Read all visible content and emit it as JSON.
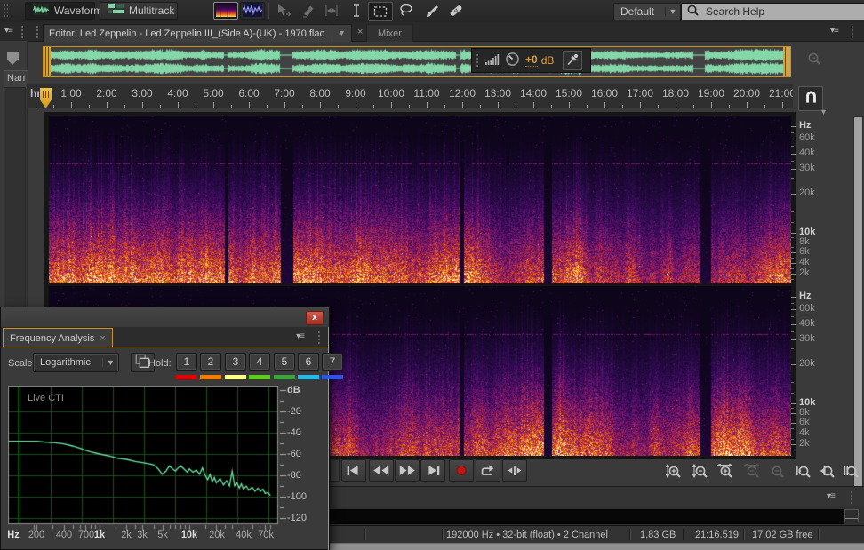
{
  "toolbar": {
    "waveform_label": "Waveform",
    "multitrack_label": "Multitrack",
    "workspace_value": "Default",
    "search_placeholder": "Search Help",
    "tools": [
      "move-tool",
      "slip-tool",
      "stretch-tool",
      "time-selection-tool",
      "marquee-selection-tool",
      "lasso-selection-tool",
      "paintbrush-tool",
      "spot-healing-brush-tool"
    ]
  },
  "tab_bar": {
    "editor_tab": "Editor: Led Zeppelin - Led Zeppelin III_(Side A)-(UK) - 1970.flac",
    "editor_close": "×",
    "mixer_tab": "Mixer"
  },
  "left_rail": {
    "column_header": "Nan"
  },
  "overview": {
    "gain_value": "+0",
    "gain_unit": "dB"
  },
  "ruler": {
    "unit": "hms",
    "ticks": [
      "1:00",
      "2:00",
      "3:00",
      "4:00",
      "5:00",
      "6:00",
      "7:00",
      "8:00",
      "9:00",
      "10:00",
      "11:00",
      "12:00",
      "13:00",
      "14:00",
      "15:00",
      "16:00",
      "17:00",
      "18:00",
      "19:00",
      "20:00",
      "21:00"
    ]
  },
  "spectrogram": {
    "channels": 2,
    "axis_labels": [
      "Hz",
      "60k",
      "40k",
      "30k",
      "20k",
      "10k",
      "8k",
      "6k",
      "4k",
      "2k"
    ],
    "axis_bold": [
      true,
      false,
      false,
      false,
      false,
      true,
      false,
      false,
      false,
      false
    ]
  },
  "transport": {
    "buttons": [
      "skip-to-start",
      "rewind",
      "fast-forward",
      "skip-to-end",
      "record",
      "loop-playback",
      "skip-selection"
    ]
  },
  "zoom_bar": {
    "buttons": [
      "zoom-in-amplitude",
      "zoom-out-amplitude",
      "zoom-in-time",
      "zoom-out-time",
      "zoom-reset",
      "zoom-in-left-selection",
      "zoom-in-right-selection",
      "zoom-to-selection"
    ]
  },
  "status_bar": {
    "segments": [
      "192000 Hz • 32-bit (float) • 2 Channel",
      "1,83 GB",
      "21:16.519",
      "17,02 GB free"
    ]
  },
  "freq_panel": {
    "tab_title": "Frequency Analysis",
    "tab_close": "×",
    "scale_label": "Scale:",
    "scale_value": "Logarithmic",
    "hold_label": "Hold:",
    "hold_buttons": [
      {
        "label": "1",
        "color": "#e00000"
      },
      {
        "label": "2",
        "color": "#f07d00"
      },
      {
        "label": "3",
        "color": "#ffff8c"
      },
      {
        "label": "4",
        "color": "#5ecc1e"
      },
      {
        "label": "5",
        "color": "#3da33d"
      },
      {
        "label": "6",
        "color": "#28b8e8"
      },
      {
        "label": "7",
        "color": "#2f55e0"
      }
    ],
    "overlay_label": "Live CTI"
  },
  "chart_data": {
    "type": "line",
    "title": "Frequency Analysis",
    "xlabel": "Hz",
    "ylabel": "dB",
    "x_scale": "log",
    "x_ticks": [
      "Hz",
      "200",
      "400",
      "700",
      "1k",
      "2k",
      "3k",
      "5k",
      "10k",
      "20k",
      "40k",
      "70k"
    ],
    "x_ticks_bold": [
      true,
      false,
      false,
      false,
      true,
      false,
      false,
      false,
      true,
      false,
      false,
      false
    ],
    "y_ticks": [
      "dB",
      "-20",
      "-40",
      "-60",
      "-80",
      "-100",
      "-120"
    ],
    "ylim": [
      -126,
      0
    ],
    "grid": true,
    "legend_position": "top-left",
    "series": [
      {
        "name": "Live CTI",
        "points": [
          [
            95,
            -48
          ],
          [
            150,
            -48
          ],
          [
            200,
            -48
          ],
          [
            260,
            -49
          ],
          [
            320,
            -49.5
          ],
          [
            400,
            -50.5
          ],
          [
            500,
            -52.5
          ],
          [
            600,
            -54.5
          ],
          [
            700,
            -56.5
          ],
          [
            800,
            -58
          ],
          [
            1000,
            -60
          ],
          [
            1300,
            -62
          ],
          [
            1600,
            -64
          ],
          [
            2000,
            -65
          ],
          [
            2500,
            -67
          ],
          [
            3000,
            -68
          ],
          [
            3500,
            -69
          ],
          [
            4000,
            -70
          ],
          [
            4500,
            -74
          ],
          [
            5000,
            -79
          ],
          [
            5500,
            -76
          ],
          [
            6000,
            -71
          ],
          [
            6500,
            -74
          ],
          [
            7000,
            -76
          ],
          [
            7500,
            -73
          ],
          [
            8000,
            -71
          ],
          [
            8700,
            -74
          ],
          [
            9500,
            -77
          ],
          [
            10000,
            -74
          ],
          [
            11000,
            -77
          ],
          [
            12000,
            -75
          ],
          [
            13000,
            -79
          ],
          [
            14000,
            -73
          ],
          [
            15000,
            -80
          ],
          [
            16000,
            -84
          ],
          [
            17000,
            -79
          ],
          [
            18000,
            -86
          ],
          [
            19000,
            -82
          ],
          [
            20000,
            -87
          ],
          [
            22000,
            -83
          ],
          [
            24000,
            -89
          ],
          [
            26000,
            -85
          ],
          [
            28000,
            -90
          ],
          [
            30000,
            -76
          ],
          [
            32000,
            -90
          ],
          [
            34000,
            -87
          ],
          [
            36000,
            -92
          ],
          [
            38000,
            -88
          ],
          [
            40000,
            -93
          ],
          [
            43000,
            -90
          ],
          [
            46000,
            -94
          ],
          [
            50000,
            -91
          ],
          [
            54000,
            -95
          ],
          [
            58000,
            -92
          ],
          [
            62000,
            -95
          ],
          [
            66000,
            -93
          ],
          [
            70000,
            -97
          ],
          [
            75000,
            -96
          ],
          [
            80000,
            -99
          ]
        ]
      }
    ]
  }
}
